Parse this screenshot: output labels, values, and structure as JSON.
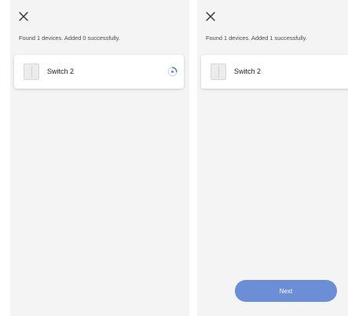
{
  "screens": [
    {
      "close_icon": "close-icon",
      "status_text": "Found 1 devices. Added 0 successfully.",
      "device": {
        "name": "Switch 2",
        "state_icon": "loading-spinner-icon"
      }
    },
    {
      "close_icon": "close-icon",
      "status_text": "Found 1 devices. Added 1 successfully.",
      "device": {
        "name": "Switch 2"
      },
      "next_label": "Next"
    }
  ],
  "colors": {
    "background": "#f4f4f4",
    "card": "#ffffff",
    "accent": "#6b8ed6",
    "spinner": "#3a7bd5"
  }
}
